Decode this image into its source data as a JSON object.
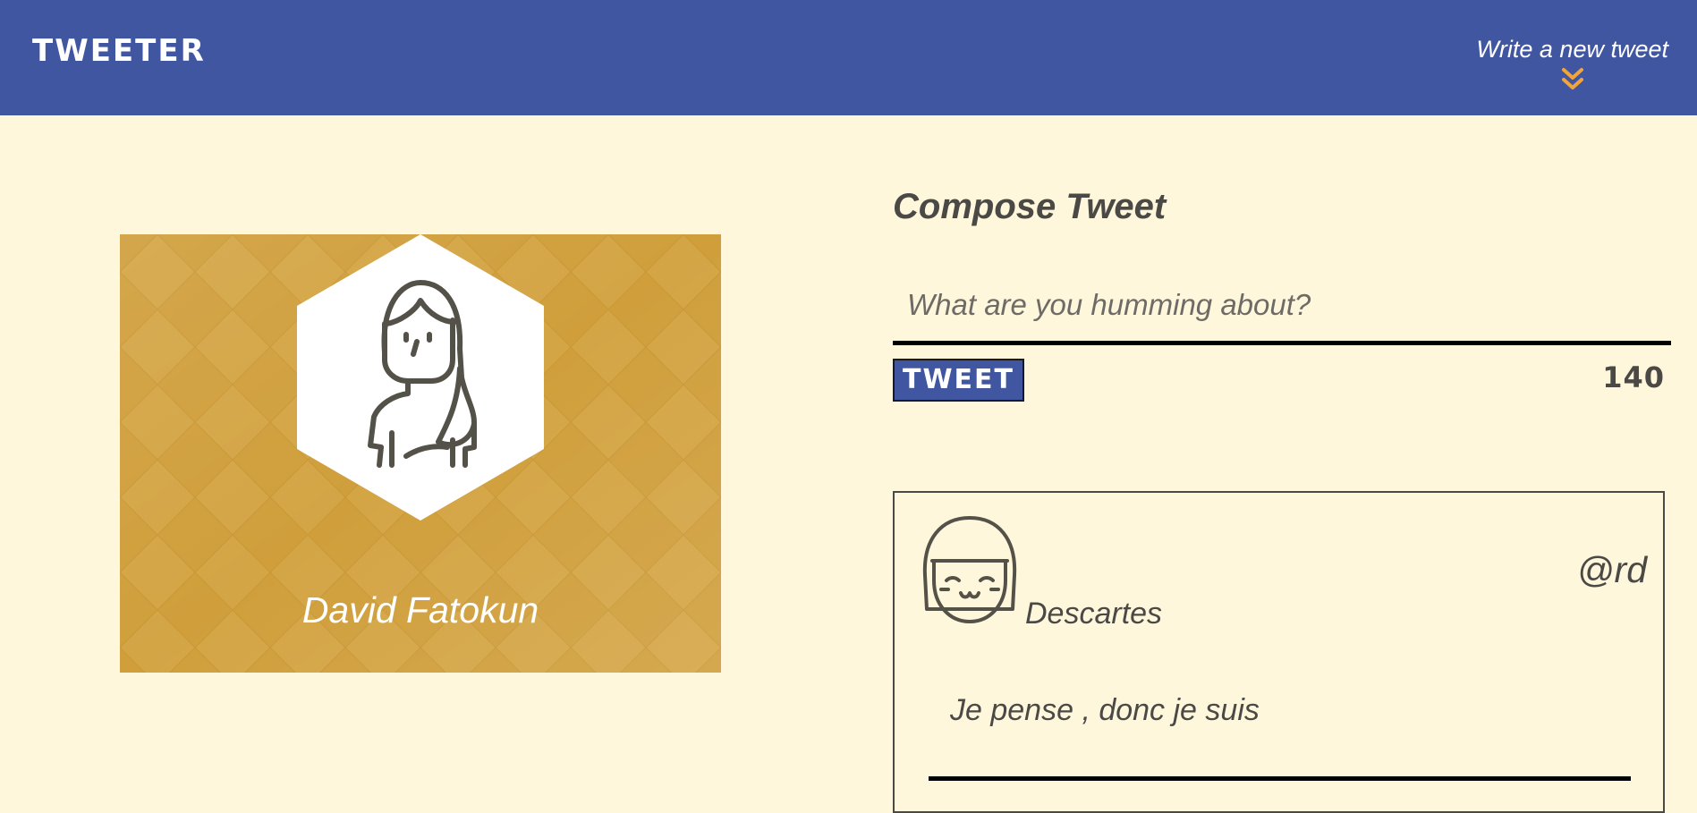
{
  "header": {
    "logo": "TWEETER",
    "compose_toggle_label": "Write a new tweet",
    "compose_toggle_icon": "double-chevron-down-icon"
  },
  "profile": {
    "name": "David Fatokun",
    "avatar_icon": "woman-avatar-icon"
  },
  "compose": {
    "title": "Compose Tweet",
    "placeholder": "What are you humming about?",
    "value": "",
    "submit_label": "TWEET",
    "counter": "140"
  },
  "tweets": [
    {
      "author": "Descartes",
      "handle": "@rd",
      "text": "Je pense , donc je suis",
      "avatar_icon": "smiling-girl-avatar-icon"
    }
  ],
  "colors": {
    "header_bg": "#4056a1",
    "page_bg": "#fff7dc",
    "accent_arrow": "#f3a43b",
    "profile_card_bg": "#d09f3c",
    "text": "#4a4945"
  }
}
